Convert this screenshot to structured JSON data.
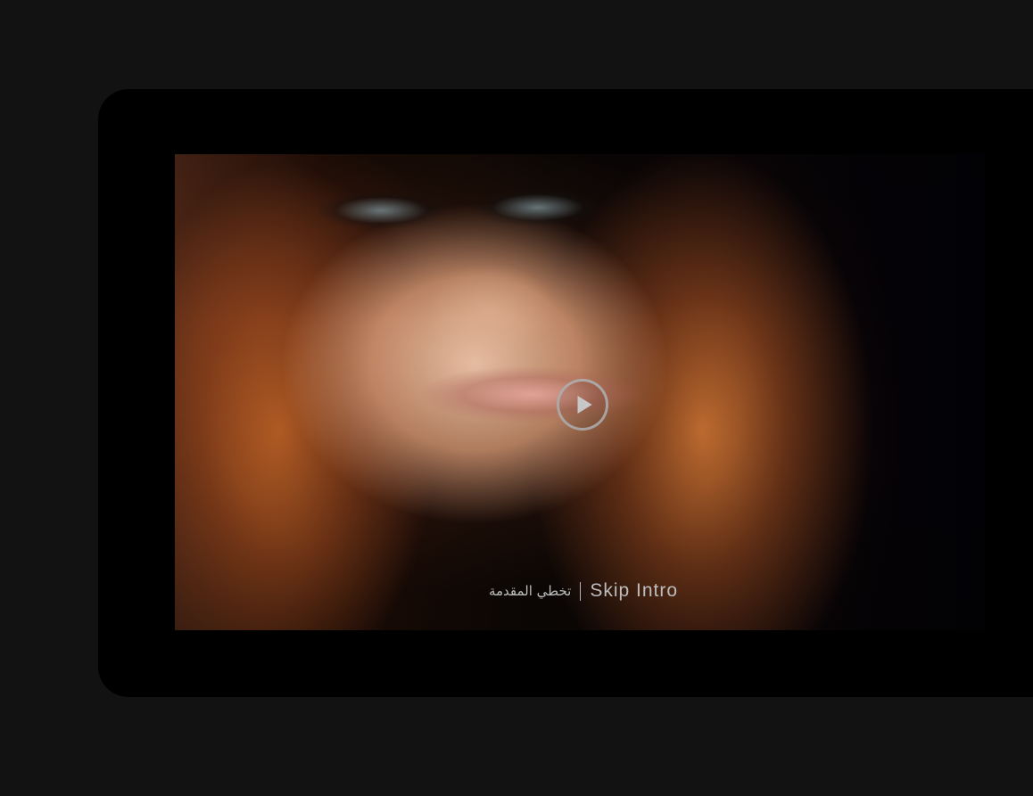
{
  "video": {
    "play_icon": "play-icon",
    "skip_intro_ar": "تخطي المقدمة",
    "skip_intro_en": "Skip Intro"
  }
}
